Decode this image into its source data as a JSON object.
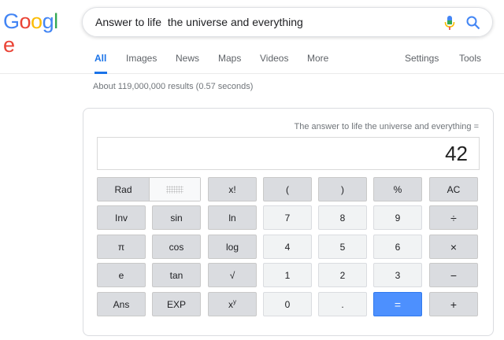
{
  "logo": {
    "text": "Google",
    "colors": [
      "#4285F4",
      "#EA4335",
      "#FBBC05",
      "#4285F4",
      "#34A853",
      "#EA4335"
    ]
  },
  "search": {
    "query": "Answer to life  the universe and everything"
  },
  "tabs": [
    {
      "label": "All",
      "active": true
    },
    {
      "label": "Images"
    },
    {
      "label": "News"
    },
    {
      "label": "Maps"
    },
    {
      "label": "Videos"
    },
    {
      "label": "More"
    },
    {
      "label": "Settings"
    },
    {
      "label": "Tools"
    }
  ],
  "result_stats": "About 119,000,000 results (0.57 seconds)",
  "calculator": {
    "expression": "The answer to life the universe and everything =",
    "result": "42",
    "rad_label": "Rad",
    "keys": {
      "fact": "x!",
      "lparen": "(",
      "rparen": ")",
      "percent": "%",
      "ac": "AC",
      "inv": "Inv",
      "sin": "sin",
      "ln": "ln",
      "k7": "7",
      "k8": "8",
      "k9": "9",
      "divide": "÷",
      "pi": "π",
      "cos": "cos",
      "log": "log",
      "k4": "4",
      "k5": "5",
      "k6": "6",
      "multiply": "×",
      "e": "e",
      "tan": "tan",
      "sqrt": "√",
      "k1": "1",
      "k2": "2",
      "k3": "3",
      "minus": "−",
      "ans": "Ans",
      "exp": "EXP",
      "pow_base": "x",
      "pow_exp": "y",
      "k0": "0",
      "dot": ".",
      "equals": "=",
      "plus": "+"
    },
    "accent": "#4d90fe"
  }
}
